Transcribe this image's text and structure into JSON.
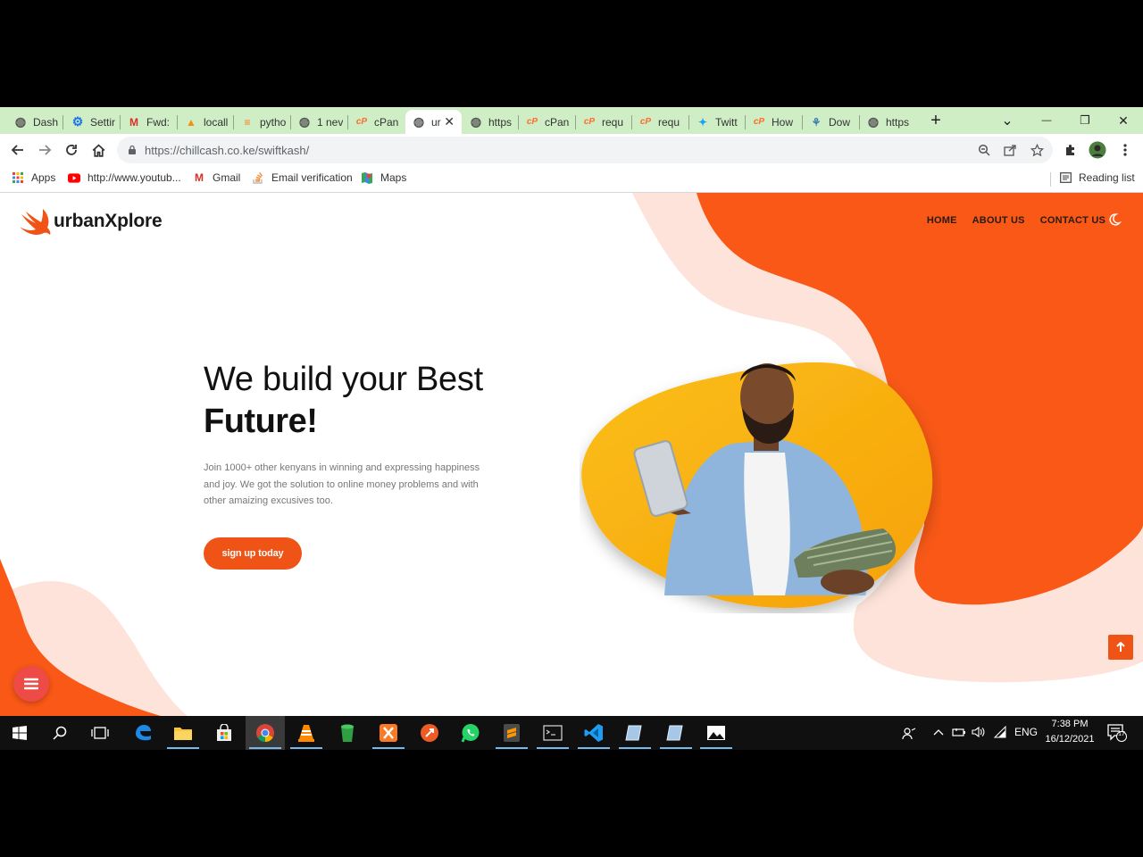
{
  "browser": {
    "tabs": [
      {
        "label": "Dash",
        "icon": "globe-icon",
        "color": "#555555"
      },
      {
        "label": "Settir",
        "icon": "gear-icon",
        "color": "#1a73e8"
      },
      {
        "label": "Fwd:",
        "icon": "gmail-icon",
        "color": "#d93025"
      },
      {
        "label": "locall",
        "icon": "phpmyadmin-icon",
        "color": "#f29111"
      },
      {
        "label": "pytho",
        "icon": "stackoverflow-icon",
        "color": "#f48024"
      },
      {
        "label": "1 nev",
        "icon": "globe-icon",
        "color": "#555555"
      },
      {
        "label": "cPan",
        "icon": "cpanel-icon",
        "color": "#ff6c2c"
      },
      {
        "label": "ur",
        "icon": "globe-icon",
        "color": "#555555",
        "active": true
      },
      {
        "label": "https",
        "icon": "globe-icon",
        "color": "#555555"
      },
      {
        "label": "cPan",
        "icon": "cpanel-icon",
        "color": "#ff6c2c"
      },
      {
        "label": "requ",
        "icon": "cpanel-icon",
        "color": "#ff6c2c"
      },
      {
        "label": "requ",
        "icon": "cpanel-icon",
        "color": "#ff6c2c"
      },
      {
        "label": "Twitt",
        "icon": "twitter-icon",
        "color": "#1da1f2"
      },
      {
        "label": "How",
        "icon": "cpanel-icon",
        "color": "#ff6c2c"
      },
      {
        "label": "Dow",
        "icon": "python-icon",
        "color": "#3776ab"
      },
      {
        "label": "https",
        "icon": "globe-icon",
        "color": "#555555"
      }
    ],
    "address_url": "https://chillcash.co.ke/swiftkash/",
    "bookmarks": [
      {
        "label": "Apps",
        "icon": "apps-grid-icon"
      },
      {
        "label": "http://www.youtub...",
        "icon": "youtube-icon"
      },
      {
        "label": "Gmail",
        "icon": "gmail-icon"
      },
      {
        "label": "Email verification",
        "icon": "stackoverflow-icon"
      },
      {
        "label": "Maps",
        "icon": "maps-icon"
      }
    ],
    "reading_list_label": "Reading list"
  },
  "site": {
    "logo_text": "urbanXplore",
    "nav": [
      "HOME",
      "ABOUT US",
      "CONTACT US"
    ],
    "hero": {
      "title_line1": "We build your Best",
      "title_line2": "Future!",
      "description": "Join 1000+ other kenyans in winning and expressing happiness and joy. We got the solution to online money problems and with other amaizing excusives too.",
      "cta": "sign up today"
    },
    "accent": "#f05316",
    "accent_light": "#fde3d9"
  },
  "taskbar": {
    "language": "ENG",
    "time": "7:38 PM",
    "date": "16/12/2021",
    "notification_count": "17"
  }
}
